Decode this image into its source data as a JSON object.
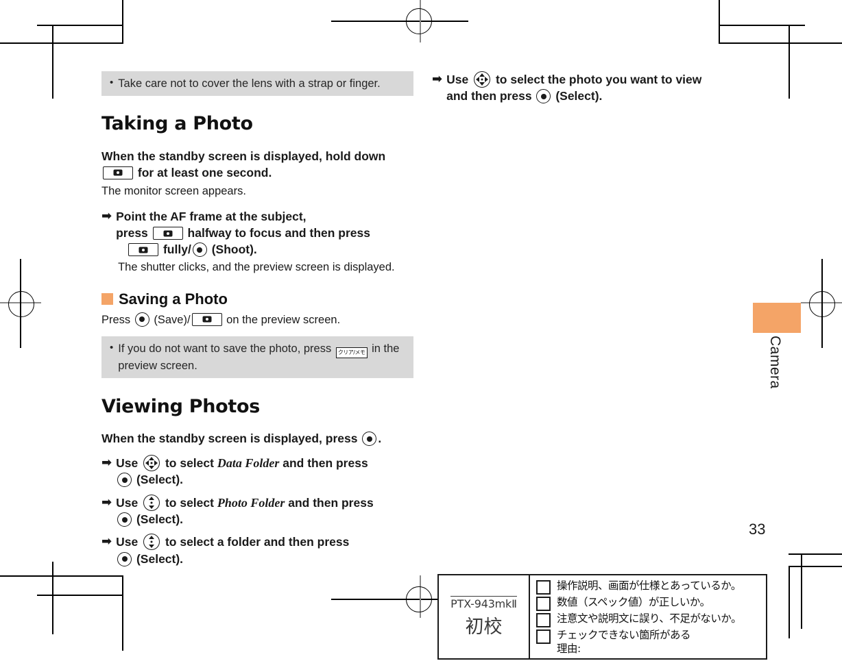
{
  "colors": {
    "accent": "#F4A467",
    "note_bg": "#d8d8d8",
    "ink": "#1a1a1a"
  },
  "left_column": {
    "top_note": {
      "bullet": "•",
      "text": "Take care not to cover the lens with a strap or finger."
    },
    "section1": {
      "heading": "Taking a Photo",
      "lead_a": "When the standby screen is displayed, hold down",
      "lead_b": "for at least one second.",
      "result": "The monitor screen appears.",
      "step": {
        "arrow": "➡",
        "line1": "Point the AF frame at the subject,",
        "line2_a": "press",
        "line2_b": "halfway to focus and then press",
        "line3_a": "fully/",
        "line3_b": "(Shoot).",
        "result": "The shutter clicks, and the preview screen is displayed."
      },
      "subheading": "Saving a Photo",
      "save_a": "Press",
      "save_b": "(Save)/",
      "save_c": "on the preview screen.",
      "note": {
        "bullet": "•",
        "text_a": "If you do not want to save the photo, press",
        "key": "クリア/メモ",
        "text_b": "in the preview screen."
      }
    },
    "section2": {
      "heading": "Viewing Photos",
      "lead_a": "When the standby screen is displayed, press",
      "lead_b": ".",
      "steps": [
        {
          "arrow": "➡",
          "pre": "Use",
          "mid": "to select",
          "italic": "Data Folder",
          "post": "and then press",
          "tail": "(Select).",
          "pad": "4way"
        },
        {
          "arrow": "➡",
          "pre": "Use",
          "mid": "to select",
          "italic": "Photo Folder",
          "post": "and then press",
          "tail": "(Select).",
          "pad": "updown"
        },
        {
          "arrow": "➡",
          "pre": "Use",
          "mid": "to select a folder and then press",
          "italic": "",
          "post": "",
          "tail": "(Select).",
          "pad": "updown"
        }
      ]
    }
  },
  "right_column": {
    "step": {
      "arrow": "➡",
      "pre": "Use",
      "mid": "to select the photo you want to view",
      "line2_a": "and then press",
      "line2_b": "(Select)."
    }
  },
  "thumb_tab": {
    "label": "Camera"
  },
  "page_number": "33",
  "proof_stamp": {
    "code": "PTX-943mkⅡ",
    "stage": "初校",
    "checklist": [
      "操作説明、画面が仕様とあっているか。",
      "数値（スペック値）が正しいか。",
      "注意文や説明文に誤り、不足がないか。",
      "チェックできない箇所がある"
    ],
    "reason_label": "理由:"
  }
}
